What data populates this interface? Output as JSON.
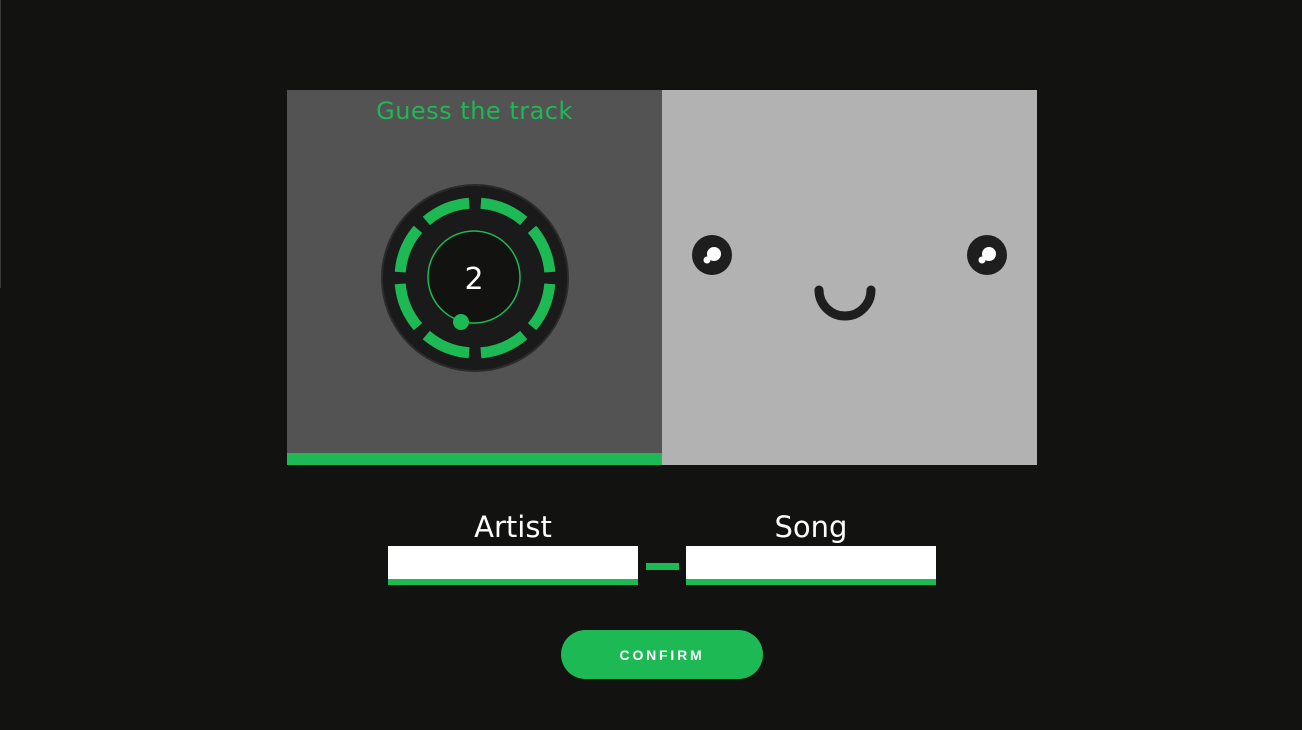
{
  "player": {
    "title": "Guess the track",
    "countdown": "2",
    "progress": 1.0
  },
  "form": {
    "artist_label": "Artist",
    "artist_value": "",
    "song_label": "Song",
    "song_value": ""
  },
  "actions": {
    "confirm_label": "CONFIRM"
  },
  "colors": {
    "background": "#121211",
    "accent": "#1db954",
    "player_card": "#535353",
    "cover_card": "#b1b2b1",
    "face_features": "#1e1e1e"
  },
  "icons": {
    "timer": "countdown-ring-icon",
    "cover_face": "smiley-face-icon"
  }
}
